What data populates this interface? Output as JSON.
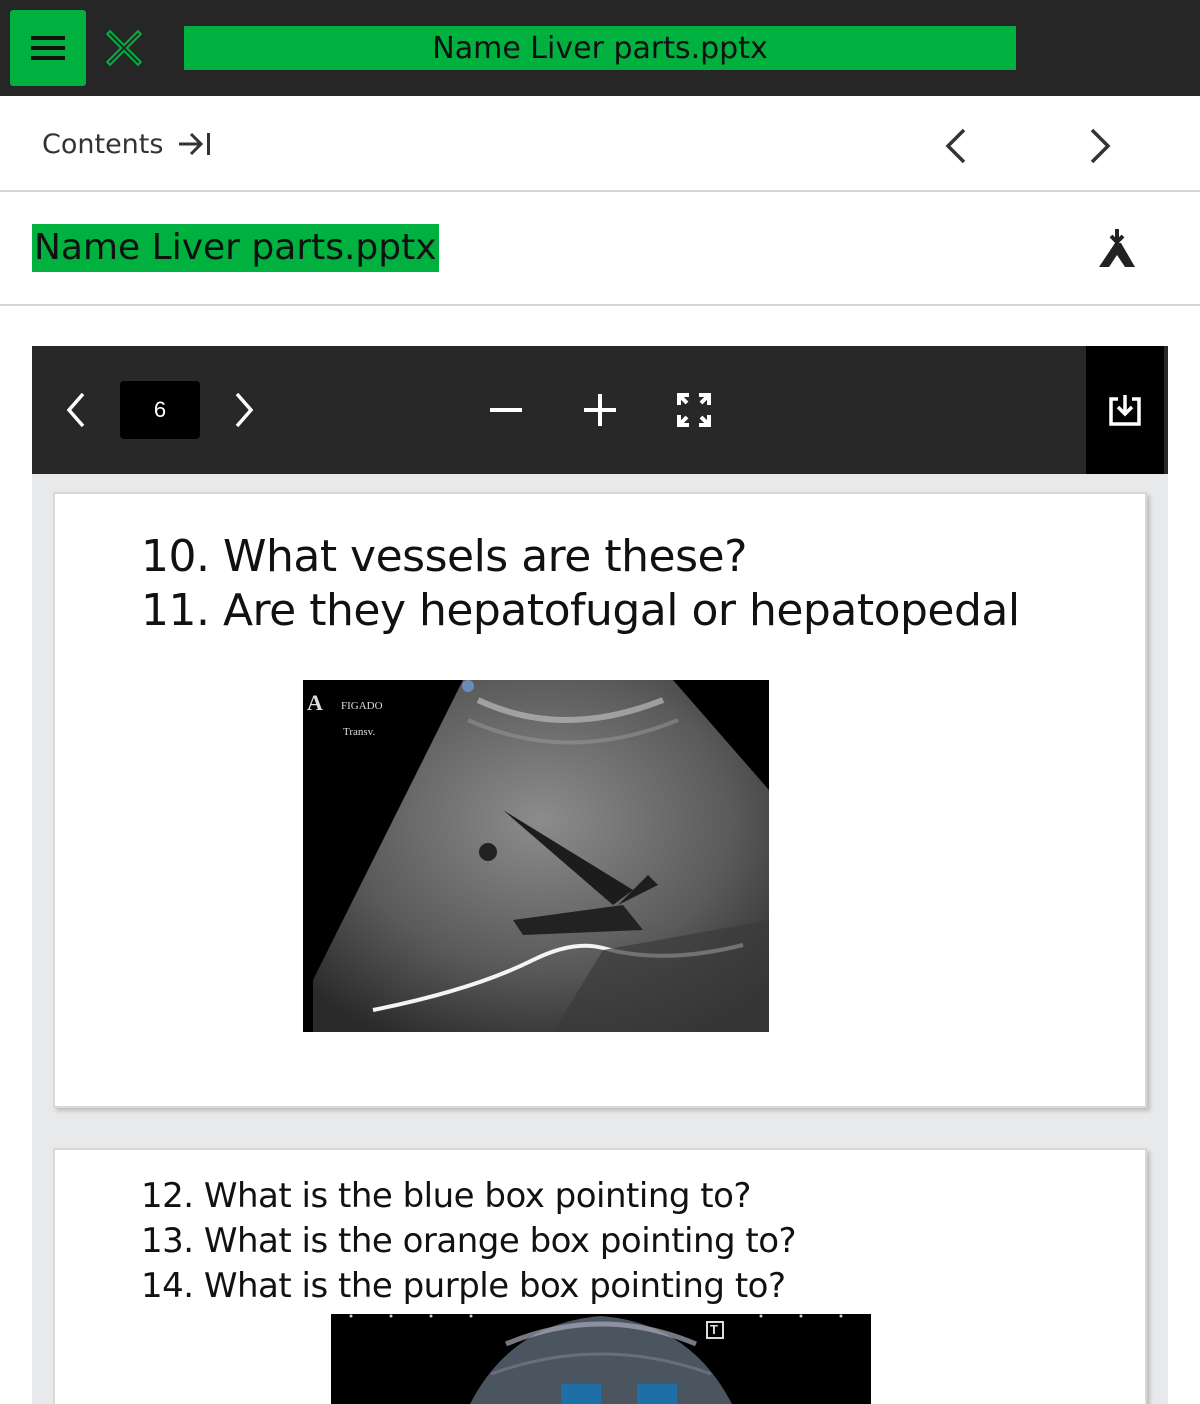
{
  "topbar": {
    "title": "Name Liver parts.pptx",
    "menu_icon": "hamburger-icon",
    "close_icon": "close-x-icon",
    "accent_color": "#00b140"
  },
  "nav": {
    "contents_label": "Contents",
    "contents_icon": "arrow-to-end-icon",
    "prev_icon": "chevron-left-icon",
    "next_icon": "chevron-right-icon"
  },
  "file": {
    "title": "Name Liver parts.pptx",
    "accessibility_icon": "accessibility-download-icon"
  },
  "viewer": {
    "page": "6",
    "prev_icon": "chevron-left-icon",
    "next_icon": "chevron-right-icon",
    "zoom_out_icon": "minus-icon",
    "zoom_in_icon": "plus-icon",
    "fullscreen_icon": "fullscreen-icon",
    "download_icon": "download-icon"
  },
  "slides": [
    {
      "questions": [
        "10. What vessels are these?",
        "11. Are they hepatofugal or hepatopedal"
      ],
      "image_labels": {
        "marker": "A",
        "organ": "FIGADO",
        "view": "Transv."
      }
    },
    {
      "questions": [
        "12. What is the blue box pointing to?",
        "13. What is the orange box pointing to?",
        "14. What is the purple box pointing to?"
      ],
      "image_labels": {
        "marker": "T"
      }
    }
  ]
}
